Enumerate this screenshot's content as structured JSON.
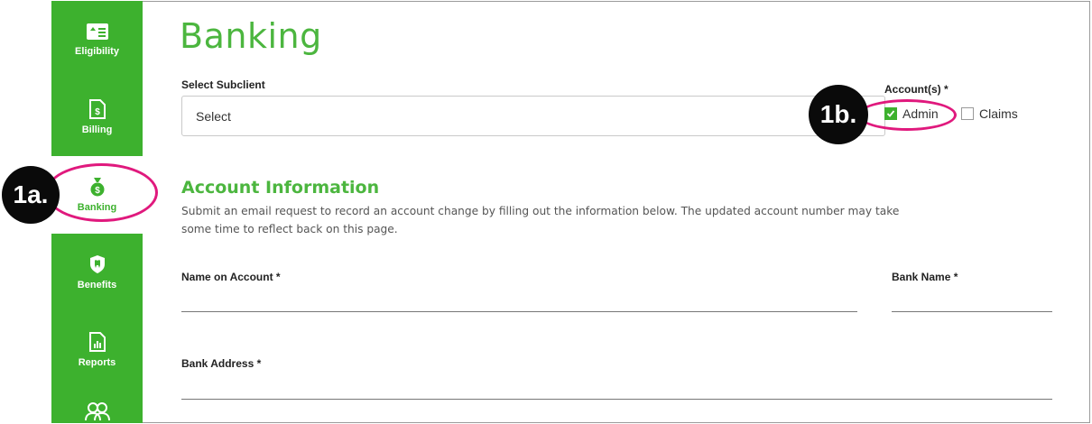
{
  "sidebar": {
    "items": [
      {
        "label": "Eligibility",
        "icon": "id-card-icon"
      },
      {
        "label": "Billing",
        "icon": "billing-doc-icon"
      },
      {
        "label": "Banking",
        "icon": "money-bag-icon",
        "active": true
      },
      {
        "label": "Benefits",
        "icon": "tooth-shield-icon"
      },
      {
        "label": "Reports",
        "icon": "report-chart-icon"
      },
      {
        "label": "",
        "icon": "users-icon"
      }
    ]
  },
  "page": {
    "title": "Banking"
  },
  "subclient": {
    "label": "Select Subclient",
    "value": "Select"
  },
  "accounts": {
    "label": "Account(s) *",
    "options": [
      {
        "label": "Admin",
        "checked": true
      },
      {
        "label": "Claims",
        "checked": false
      }
    ]
  },
  "account_info": {
    "title": "Account Information",
    "description": "Submit an email request to record an account change by filling out the information below. The updated account number may take some time to reflect back on this page.",
    "fields": {
      "name_on_account": "Name on Account *",
      "bank_name": "Bank Name *",
      "bank_address": "Bank Address *"
    }
  },
  "callouts": {
    "a": "1a.",
    "b": "1b."
  },
  "colors": {
    "brand_green": "#3db12e",
    "title_green": "#4cb63f",
    "callout_ring": "#e0197d",
    "callout_fill": "#0a0a0a"
  }
}
